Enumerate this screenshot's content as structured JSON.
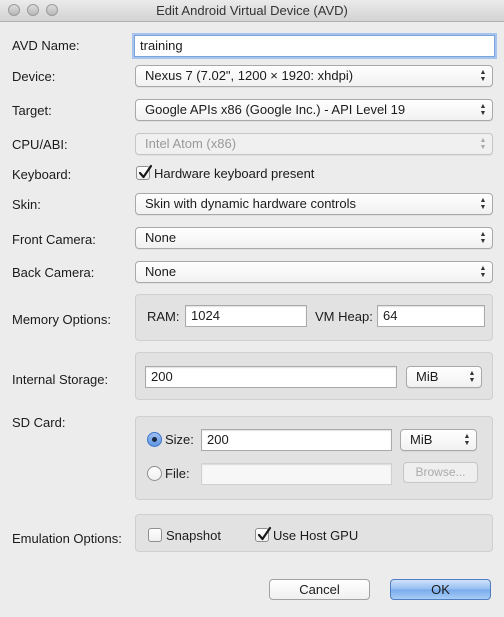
{
  "window": {
    "title": "Edit Android Virtual Device (AVD)"
  },
  "avd_name": {
    "label": "AVD Name:",
    "value": "training"
  },
  "device": {
    "label": "Device:",
    "value": "Nexus 7 (7.02\", 1200 × 1920: xhdpi)"
  },
  "target": {
    "label": "Target:",
    "value": "Google APIs x86 (Google Inc.) - API Level 19"
  },
  "cpu_abi": {
    "label": "CPU/ABI:",
    "value": "Intel Atom (x86)"
  },
  "keyboard": {
    "label": "Keyboard:",
    "checkbox_label": "Hardware keyboard present",
    "checked": true
  },
  "skin": {
    "label": "Skin:",
    "value": "Skin with dynamic hardware controls"
  },
  "front_camera": {
    "label": "Front Camera:",
    "value": "None"
  },
  "back_camera": {
    "label": "Back Camera:",
    "value": "None"
  },
  "memory": {
    "label": "Memory Options:",
    "ram_label": "RAM:",
    "ram_value": "1024",
    "heap_label": "VM Heap:",
    "heap_value": "64"
  },
  "internal_storage": {
    "label": "Internal Storage:",
    "value": "200",
    "unit": "MiB"
  },
  "sd_card": {
    "label": "SD Card:",
    "size_label": "Size:",
    "size_value": "200",
    "size_unit": "MiB",
    "file_label": "File:",
    "file_value": "",
    "browse_label": "Browse...",
    "selected": "size"
  },
  "emulation": {
    "label": "Emulation Options:",
    "snapshot_label": "Snapshot",
    "snapshot_checked": false,
    "host_gpu_label": "Use Host GPU",
    "host_gpu_checked": true
  },
  "buttons": {
    "cancel": "Cancel",
    "ok": "OK"
  },
  "colors": {
    "primary_button": "#78abec",
    "focus_ring": "#a6c4ee",
    "checkmark": "#1a1a1a"
  }
}
